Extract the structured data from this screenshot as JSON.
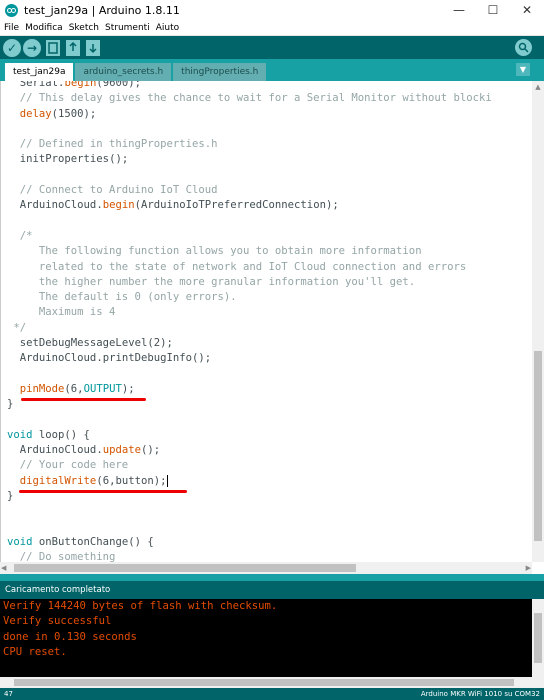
{
  "window": {
    "title": "test_jan29a | Arduino 1.8.11",
    "minimize": "—",
    "maximize": "☐",
    "close": "✕"
  },
  "menu": [
    "File",
    "Modifica",
    "Sketch",
    "Strumenti",
    "Aiuto"
  ],
  "toolbar": {
    "verify_icon": "✓",
    "upload_icon": "→",
    "new_icon": "new-icon",
    "open_icon": "open-icon",
    "save_icon": "save-icon",
    "serial_monitor_icon": "serial-monitor-icon"
  },
  "tabs": [
    {
      "label": "test_jan29a",
      "active": true
    },
    {
      "label": "arduino_secrets.h",
      "active": false
    },
    {
      "label": "thingProperties.h",
      "active": false
    }
  ],
  "code_lines": [
    "  Serial.begin(9600);",
    "  // This delay gives the chance to wait for a Serial Monitor without blocki",
    "  delay(1500);",
    "",
    "  // Defined in thingProperties.h",
    "  initProperties();",
    "",
    "  // Connect to Arduino IoT Cloud",
    "  ArduinoCloud.begin(ArduinoIoTPreferredConnection);",
    "",
    "  /*",
    "     The following function allows you to obtain more information",
    "     related to the state of network and IoT Cloud connection and errors",
    "     the higher number the more granular information you'll get.",
    "     The default is 0 (only errors).",
    "     Maximum is 4",
    " */",
    "  setDebugMessageLevel(2);",
    "  ArduinoCloud.printDebugInfo();",
    "",
    "  pinMode(6,OUTPUT);",
    "}",
    "",
    "void loop() {",
    "  ArduinoCloud.update();",
    "  // Your code here",
    "  digitalWrite(6,button);",
    "}",
    "",
    "",
    "void onButtonChange() {",
    "  // Do something"
  ],
  "status": {
    "message": "Caricamento completato"
  },
  "console": [
    "Verify 144240 bytes of flash with checksum.",
    "Verify successful",
    "done in 0.130 seconds",
    "CPU reset."
  ],
  "footer": {
    "line": "47",
    "board": "Arduino MKR WiFi 1010 su COM32"
  },
  "colors": {
    "toolbar_bg": "#006468",
    "tabbar_bg": "#17a1a5",
    "console_text": "#e34c00",
    "annotation": "#e00000"
  }
}
